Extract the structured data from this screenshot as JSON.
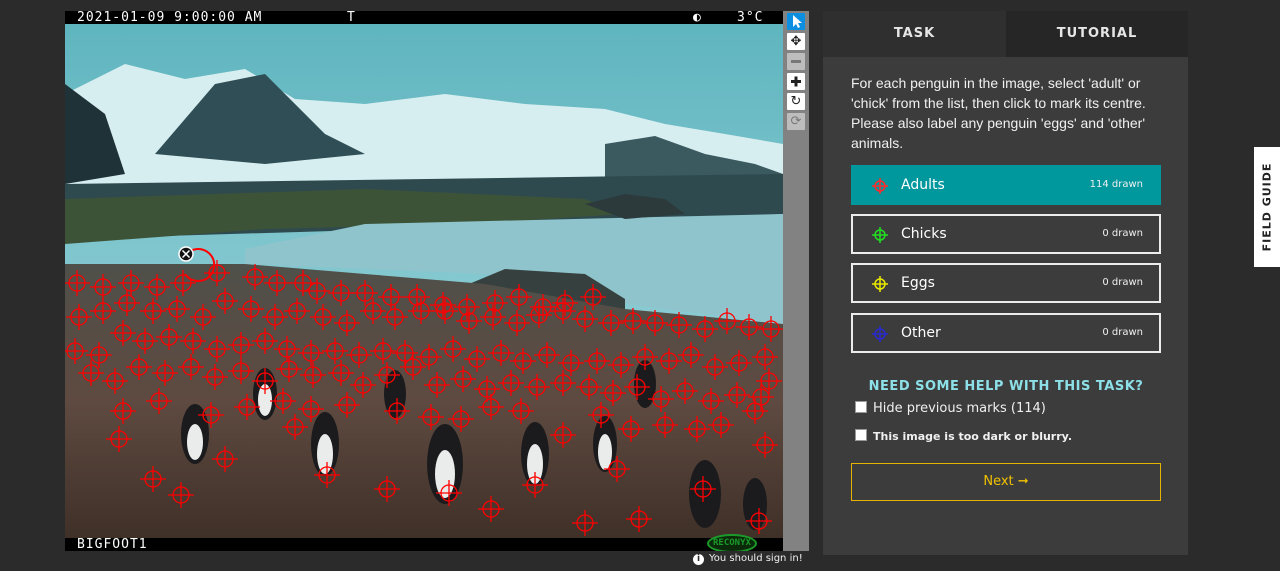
{
  "camera": {
    "timestamp": "2021-01-09 9:00:00 AM",
    "flag": "T",
    "temperature": "3°C",
    "camera_name": "BIGFOOT1",
    "logo": "RECONYX"
  },
  "toolbar": {
    "icons": [
      "pointer-icon",
      "move-icon",
      "zoom-out-icon",
      "zoom-in-icon",
      "rotate-icon",
      "reset-icon"
    ]
  },
  "tabs": {
    "task": "TASK",
    "tutorial": "TUTORIAL"
  },
  "instructions": "For each penguin in the image, select 'adult' or 'chick' from the list, then click to mark its centre. Please also label any penguin 'eggs' and 'other' animals.",
  "choices": [
    {
      "label": "Adults",
      "count": "114 drawn",
      "color": "#ff2a2a",
      "active": true
    },
    {
      "label": "Chicks",
      "count": "0 drawn",
      "color": "#20e020",
      "active": false
    },
    {
      "label": "Eggs",
      "count": "0 drawn",
      "color": "#e8e800",
      "active": false
    },
    {
      "label": "Other",
      "count": "0 drawn",
      "color": "#2a2ad0",
      "active": false
    }
  ],
  "help": "NEED SOME HELP WITH THIS TASK?",
  "checkboxes": {
    "hide_marks": "Hide previous marks (114)",
    "too_dark": "This image is too dark or blurry."
  },
  "next_label": "Next ➞",
  "field_guide": "FIELD GUIDE",
  "signin": "You should sign in!",
  "colors": {
    "accent": "#00979d",
    "mark": "#ff0000",
    "next": "#f2c200"
  }
}
